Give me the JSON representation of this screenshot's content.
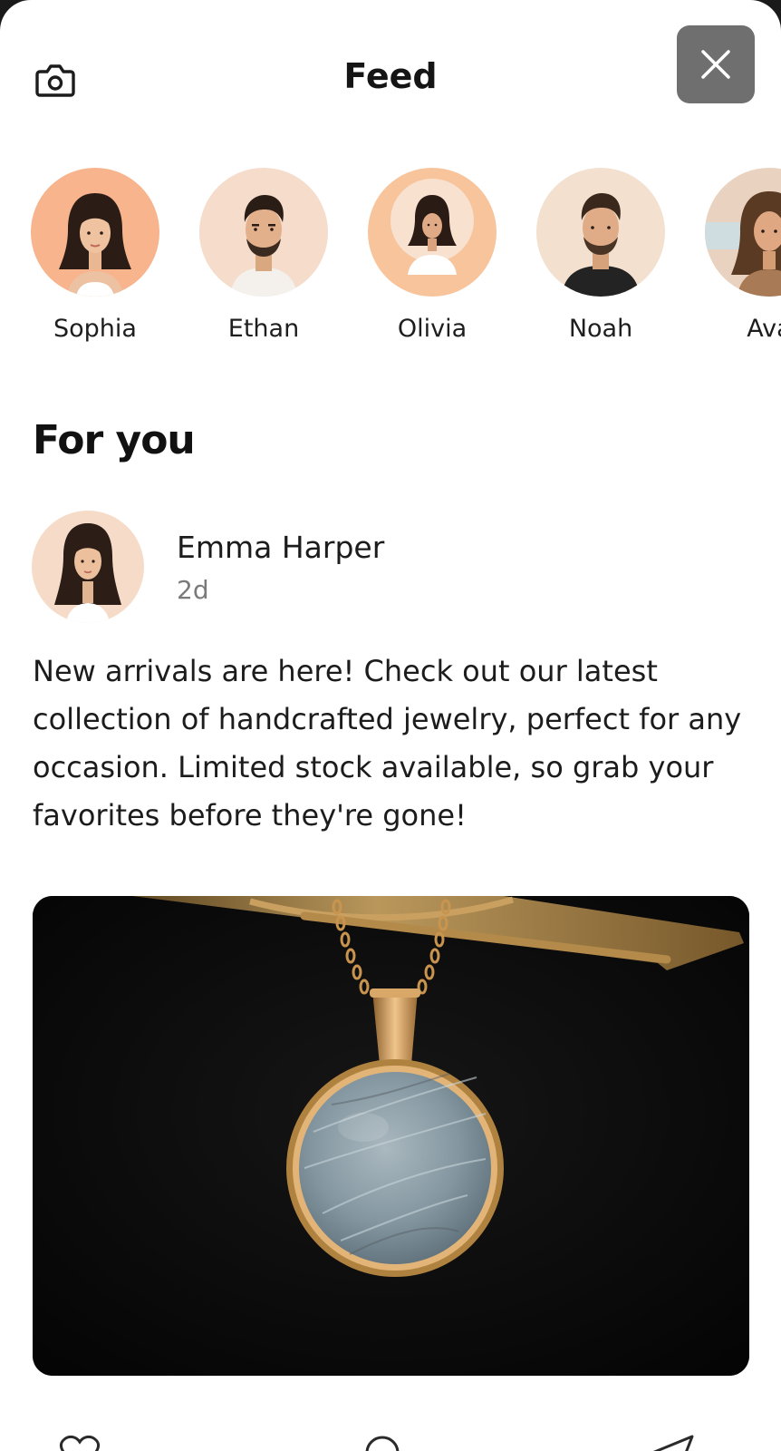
{
  "header": {
    "title": "Feed",
    "camera_icon": "camera-icon",
    "close_icon": "close-icon"
  },
  "stories": [
    {
      "name": "Sophia"
    },
    {
      "name": "Ethan"
    },
    {
      "name": "Olivia"
    },
    {
      "name": "Noah"
    },
    {
      "name": "Ava"
    }
  ],
  "section": {
    "title": "For you"
  },
  "post": {
    "author": "Emma Harper",
    "time": "2d",
    "text": "New arrivals are here! Check out our latest collection of handcrafted jewelry, perfect for any occasion. Limited stock available, so grab your favorites before they're gone!",
    "image_subject": "pendant-necklace-image"
  },
  "actions": {
    "like_icon": "heart-icon",
    "comment_icon": "comment-icon",
    "share_icon": "send-icon"
  },
  "colors": {
    "avatar_bg": "#f8c9a6",
    "avatar_bg_light": "#f5dccb",
    "close_button_bg": "#6f6f6f",
    "pendant_gold": "#c9a064",
    "pendant_stone": "#8a9aa3"
  }
}
